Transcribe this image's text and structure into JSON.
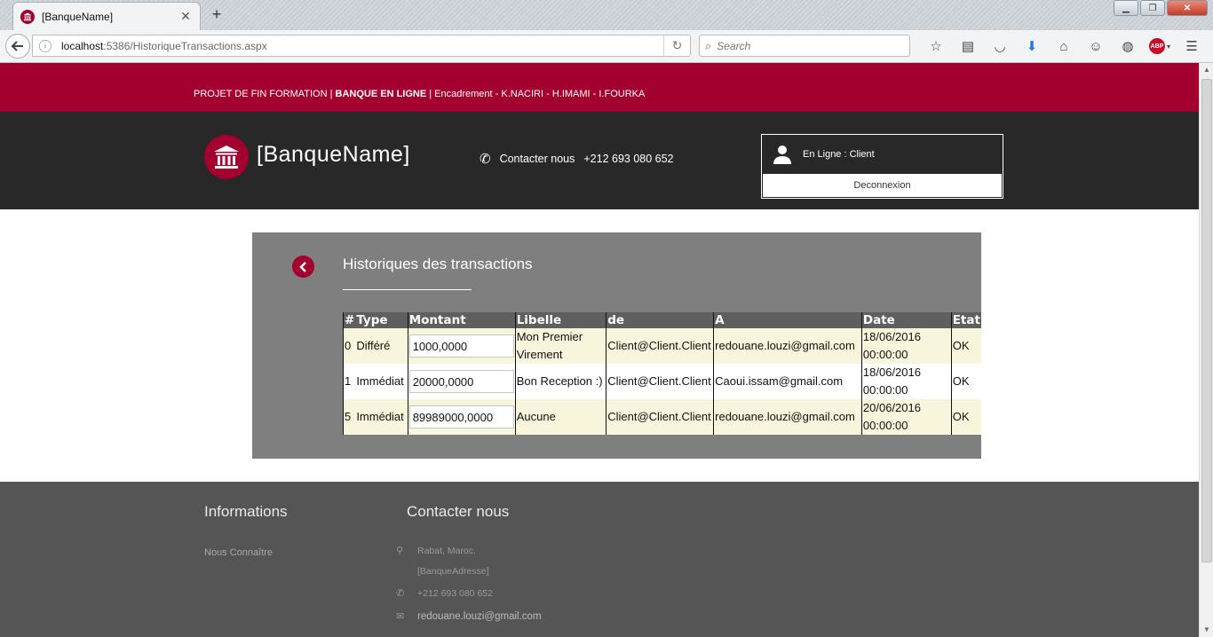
{
  "browser": {
    "tab_title": "[BanqueName]",
    "url_host": "localhost",
    "url_rest": ":5386/HistoriqueTransactions.aspx",
    "search_placeholder": "Search"
  },
  "site": {
    "top_strip": {
      "part1": "PROJET DE FIN FORMATION | ",
      "part2": "BANQUE EN LIGNE",
      "part3": " | Encadrement - K.NACIRI - H.IMAMI - I.FOURKA"
    },
    "brand": "[BanqueName]",
    "contact_label": "Contacter nous",
    "contact_phone": "+212 693 080 652",
    "user_status": "En Ligne : Client",
    "logout_label": "Deconnexion",
    "accent_color": "#a4002f"
  },
  "transactions": {
    "title": "Historiques des transactions",
    "columns": [
      "#",
      "Type",
      "Montant",
      "Libelle",
      "de",
      "A",
      "Date",
      "Etat"
    ],
    "rows": [
      {
        "id": "0",
        "type": "Différé",
        "montant": "1000,0000",
        "libelle_1": "Mon Premier",
        "libelle_2": "Virement",
        "de": "Client@Client.Client",
        "a": "redouane.louzi@gmail.com",
        "date_1": "18/06/2016",
        "date_2": "00:00:00",
        "etat": "OK"
      },
      {
        "id": "1",
        "type": "Immédiat",
        "montant": "20000,0000",
        "libelle_1": "Bon Reception :)",
        "libelle_2": "",
        "de": "Client@Client.Client",
        "a": "Caoui.issam@gmail.com",
        "date_1": "18/06/2016",
        "date_2": "00:00:00",
        "etat": "OK"
      },
      {
        "id": "5",
        "type": "Immédiat",
        "montant": "89989000,0000",
        "libelle_1": "Aucune",
        "libelle_2": "",
        "de": "Client@Client.Client",
        "a": "redouane.louzi@gmail.com",
        "date_1": "20/06/2016",
        "date_2": "00:00:00",
        "etat": "OK"
      }
    ]
  },
  "footer": {
    "informations_title": "Informations",
    "nous_connaitre": "Nous Connaître",
    "contact_title": "Contacter nous",
    "address_1": "Rabat, Maroc.",
    "address_2": "[BanqueAdresse]",
    "phone": "+212 693 080 652",
    "email": "redouane.louzi@gmail.com"
  }
}
